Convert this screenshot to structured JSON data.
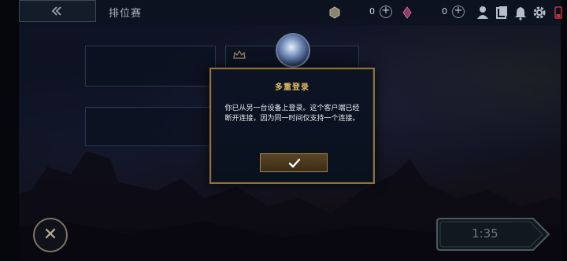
{
  "header": {
    "title": "排位赛",
    "blue_essence": {
      "value": "0",
      "icon": "blue-essence-icon"
    },
    "riot_points": {
      "value": "0",
      "icon": "wild-cores-icon"
    },
    "icons": [
      "profile-icon",
      "collection-icon",
      "notification-bell-icon",
      "gear-icon",
      "battery-icon"
    ]
  },
  "dialog": {
    "title": "多重登录",
    "message": "你已从另一台设备上登录。这个客户端已经断开连接，因为同一时间仅支持一个连接。",
    "confirm_icon": "checkmark-icon"
  },
  "footer": {
    "timer": "1:35"
  },
  "colors": {
    "gold": "#e0b964",
    "dialog_border": "#8d7242"
  }
}
